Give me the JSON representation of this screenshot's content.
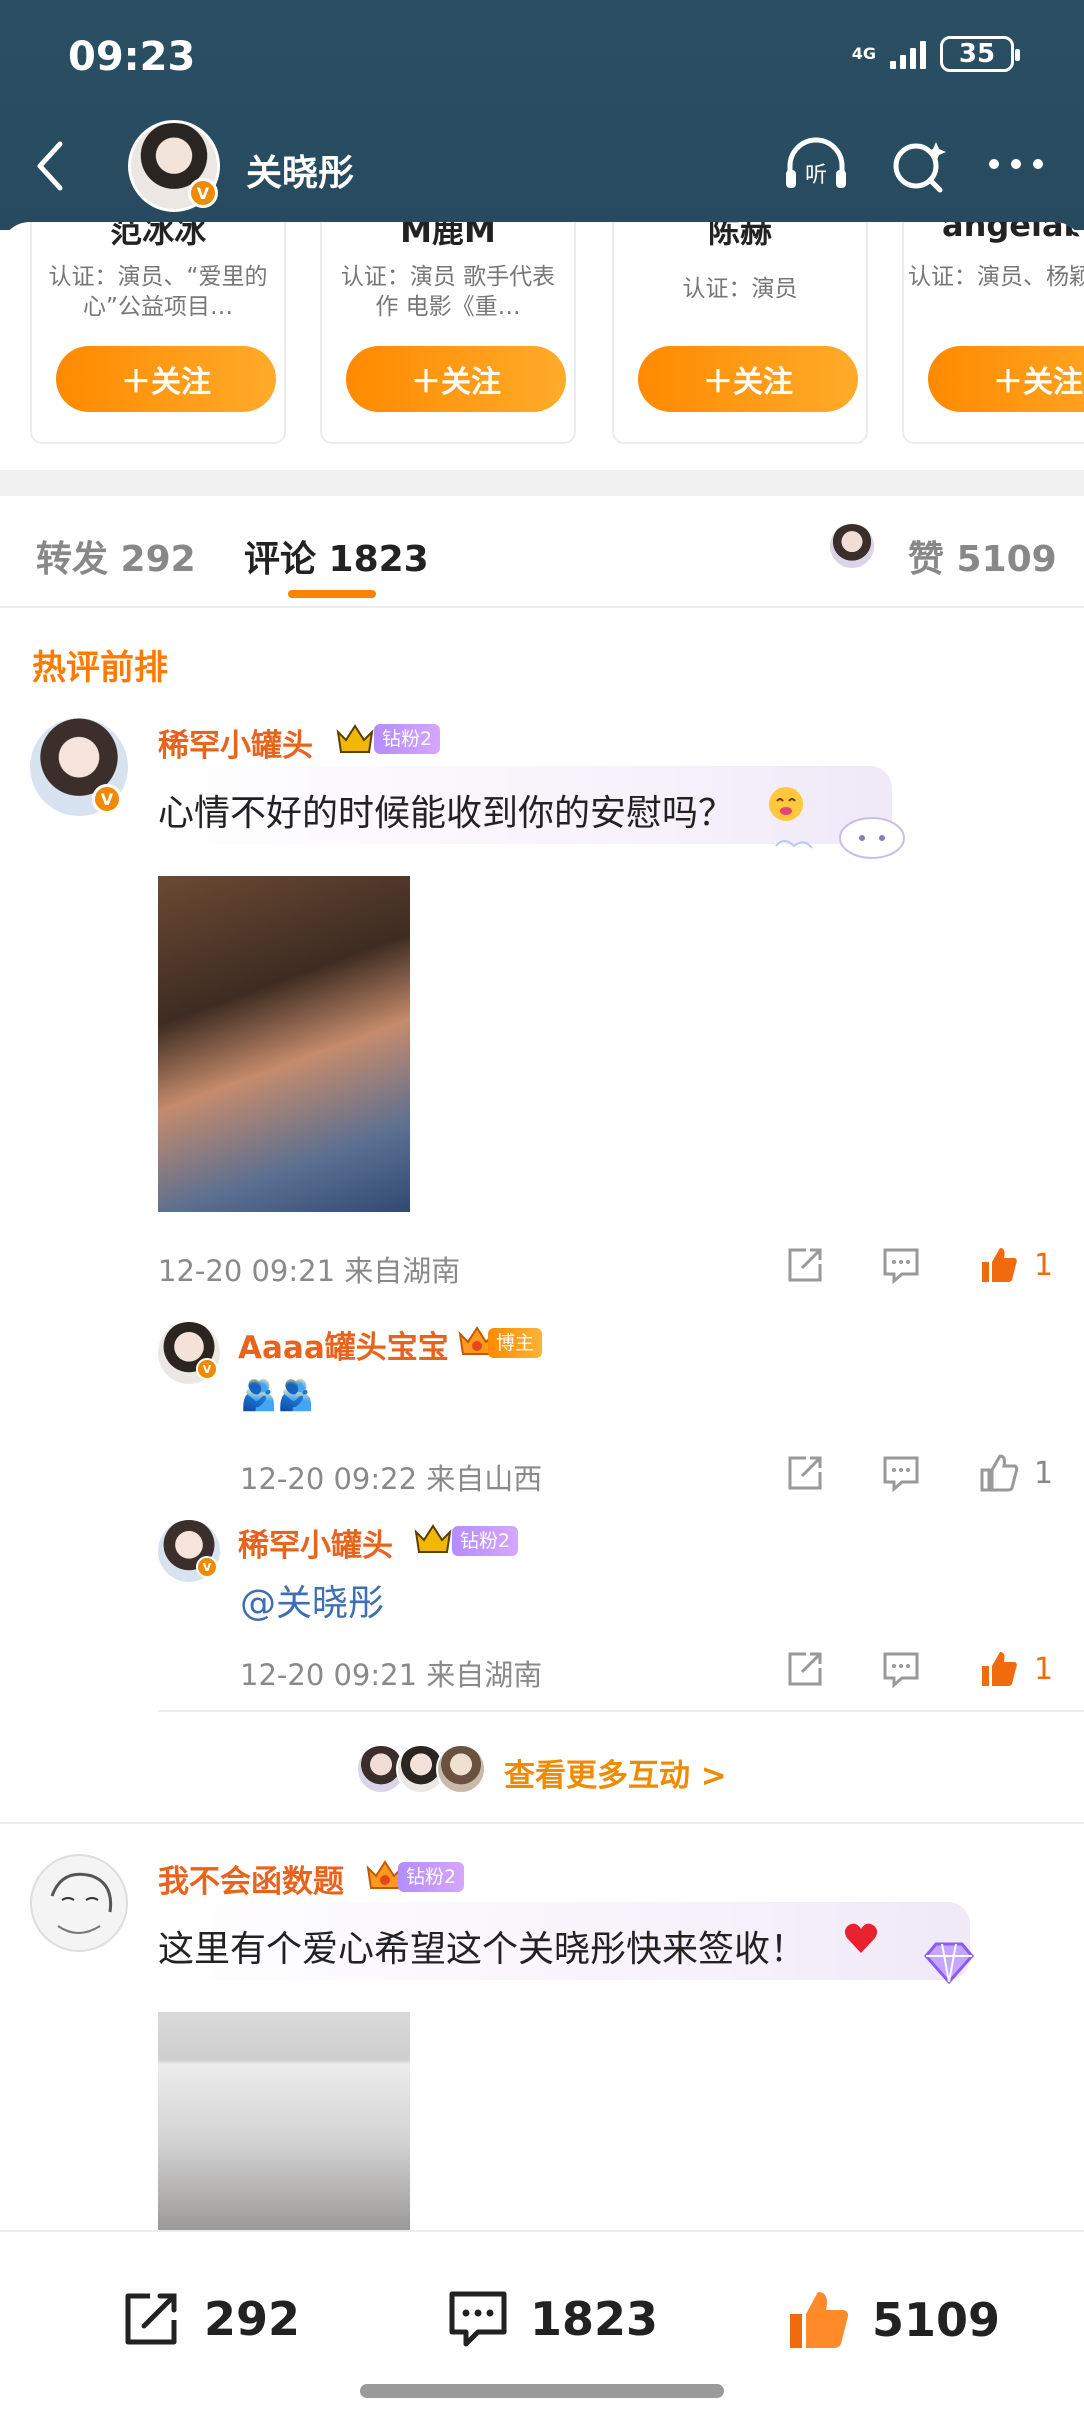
{
  "status_bar": {
    "time": "09:23",
    "network": "4G",
    "battery": "35"
  },
  "nav": {
    "title": "关晓彤"
  },
  "recommend_cards": [
    {
      "name": "范冰冰",
      "desc": "认证：演员、“爱里的心”公益项目…",
      "follow": "＋关注"
    },
    {
      "name": "M鹿M",
      "desc": "认证：演员 歌手代表作 电影《重…",
      "follow": "＋关注"
    },
    {
      "name": "陈赫",
      "desc": "认证：演员",
      "follow": "＋关注"
    },
    {
      "name": "angelab",
      "desc": "认证：演员、杨颖",
      "follow": "＋关注"
    }
  ],
  "tabs": {
    "repost": "转发 292",
    "comment": "评论 1823",
    "like": "赞 5109"
  },
  "section": {
    "title": "热评前排"
  },
  "comments": [
    {
      "user": "稀罕小罐头",
      "fan_badge": "钻粉2",
      "text": "心情不好的时候能收到你的安慰吗？",
      "meta": "12-20 09:21  来自湖南",
      "likes": "1",
      "replies": [
        {
          "user": "Aaaa罐头宝宝",
          "badge": "博主",
          "text": "🫂🫂",
          "meta": "12-20 09:22  来自山西",
          "likes": "1"
        },
        {
          "user": "稀罕小罐头",
          "badge": "钻粉2",
          "text": "@关晓彤",
          "meta": "12-20 09:21  来自湖南",
          "likes": "1"
        }
      ],
      "more": "查看更多互动 >"
    },
    {
      "user": "我不会函数题",
      "fan_badge": "钻粉2",
      "text": "这里有个爱心希望这个关晓彤快来签收！"
    }
  ],
  "bottom_bar": {
    "repost_count": "292",
    "comment_count": "1823",
    "like_count": "5109"
  },
  "colors": {
    "header_bg": "#2a4f63",
    "accent": "#ff8200",
    "username": "#e8641c",
    "mention": "#3d6fb3"
  }
}
